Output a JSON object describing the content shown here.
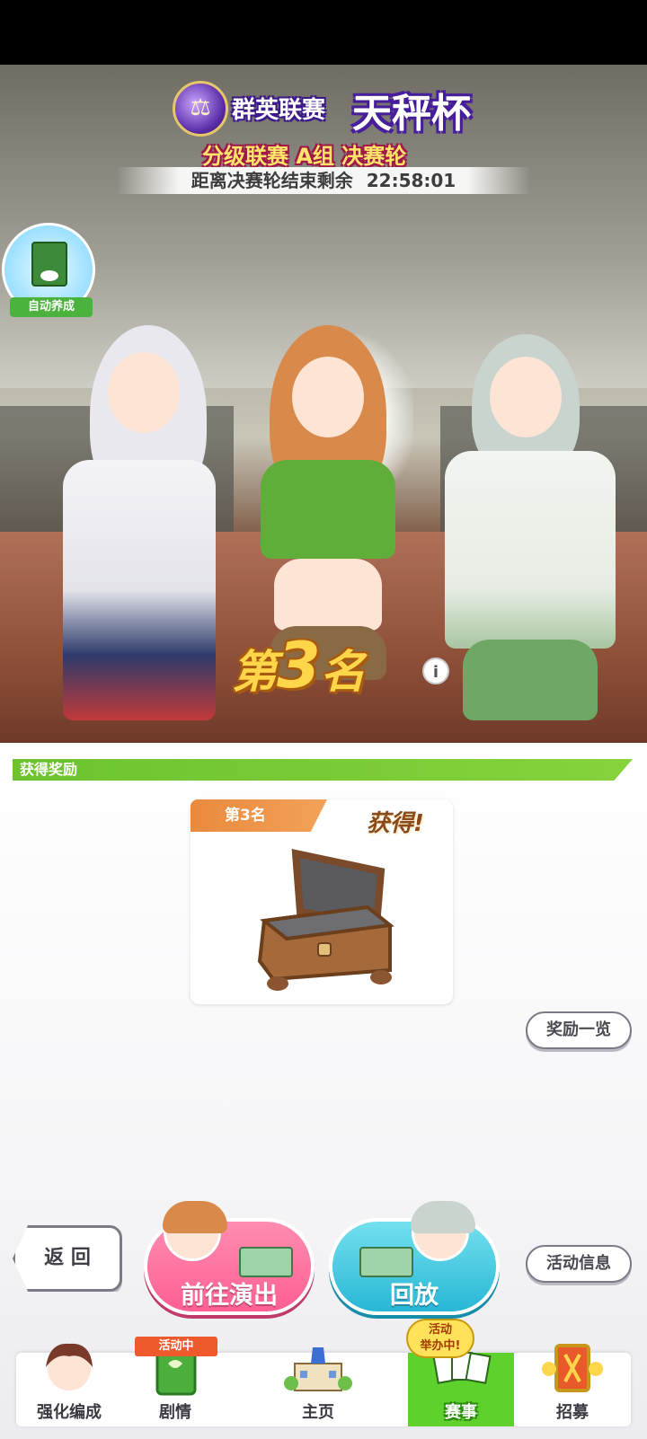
{
  "event": {
    "league_name": "群英联赛",
    "cup_name": "天秤杯",
    "stage": "分级联赛 A组 决赛轮",
    "countdown_label": "距离决赛轮结束剩余",
    "countdown_time": "22:58:01"
  },
  "auto_train": {
    "label": "自动养成"
  },
  "result": {
    "rank_prefix": "第",
    "rank_number": "3",
    "rank_suffix": "名",
    "info_icon": "i"
  },
  "rewards": {
    "header": "获得奖励",
    "card_tag": "第3名",
    "obtained": "获得!",
    "list_button": "奖励一览"
  },
  "actions": {
    "back": "返 回",
    "go_perform": "前往演出",
    "replay": "回放",
    "event_info": "活动信息"
  },
  "bottom_nav": {
    "live_badge": "活动中",
    "live_bubble": "活动\n举办中!",
    "items": [
      {
        "label": "强化编成",
        "icon": "character-icon"
      },
      {
        "label": "剧情",
        "icon": "story-book-icon"
      },
      {
        "label": "主页",
        "icon": "school-building-icon"
      },
      {
        "label": "赛事",
        "icon": "race-cards-icon"
      },
      {
        "label": "招募",
        "icon": "gacha-icon"
      }
    ]
  }
}
